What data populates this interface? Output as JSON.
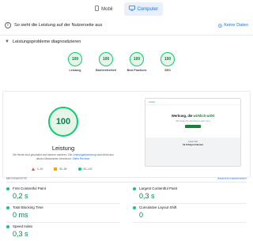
{
  "tabs": [
    {
      "label": "Mobil",
      "icon": "phone-icon",
      "active": false
    },
    {
      "label": "Computer",
      "icon": "desktop-icon",
      "active": true
    }
  ],
  "field_section": {
    "title": "So sieht die Leistung auf der Nutzerseite aus",
    "no_data_label": "Keine Daten"
  },
  "diagnose_section": {
    "title": "Leistungsprobleme diagnostizieren"
  },
  "gauges": [
    {
      "label": "Leistung",
      "score": "100"
    },
    {
      "label": "Barrierefreiheit",
      "score": "100"
    },
    {
      "label": "Best Practices",
      "score": "100"
    },
    {
      "label": "SEO",
      "score": "100"
    }
  ],
  "performance": {
    "score": "100",
    "label": "Leistung",
    "description_prefix": "Die Werte sind geschätzt und können variieren. Die ",
    "description_link": "Leistungsbewertung",
    "description_mid": " wird direkt aus diesen Messwerten berechnet. ",
    "description_link2": "Siehe Rechner."
  },
  "legend": [
    {
      "label": "0–49",
      "shape": "triangle",
      "color": "#ff4e42"
    },
    {
      "label": "50–89",
      "shape": "square",
      "color": "#ffa400"
    },
    {
      "label": "90–100",
      "shape": "circle",
      "color": "#0cce6b"
    }
  ],
  "screenshot": {
    "brand": "webflo",
    "headline_part1": "Werbung, die ",
    "headline_part2": "wirklich wirkt",
    "sub": "Wir bringen Ihr Unternehmen nach vorne",
    "bottom_title": "Unser Ziel",
    "bottom_sub": "Ihr Erfolg im Internet"
  },
  "metrics_header": {
    "title": "MESSWERTE",
    "toggle": "Ansicht maximieren"
  },
  "metrics": [
    {
      "label": "First Contentful Paint",
      "value": "0,2 s"
    },
    {
      "label": "Largest Contentful Paint",
      "value": "0,3 s"
    },
    {
      "label": "Total Blocking Time",
      "value": "0 ms"
    },
    {
      "label": "Cumulative Layout Shift",
      "value": "0"
    },
    {
      "label": "Speed Index",
      "value": "0,3 s"
    }
  ],
  "colors": {
    "good": "#0cce6b",
    "good_text": "#0d8043",
    "accent": "#1a73e8"
  }
}
